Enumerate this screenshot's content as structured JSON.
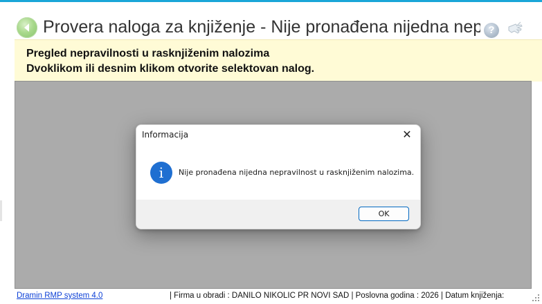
{
  "window": {
    "title": "Provera naloga za knjiženje - Nije pronađena nijedna nepravilnost",
    "back_icon": "back-arrow-icon",
    "help_icon": "help-icon",
    "help_glyph": "?",
    "pointer_icon": "hand-pointer-icon"
  },
  "info_bar": {
    "line1": "Pregled nepravilnosti u rasknjiženim nalozima",
    "line2": "Dvoklikom ili desnim klikom otvorite selektovan nalog."
  },
  "dialog": {
    "title": "Informacija",
    "close_glyph": "✕",
    "icon": "info-icon",
    "icon_glyph": "i",
    "message": "Nije pronađena nijedna nepravilnost u rasknjiženim nalozima.",
    "ok_label": "OK"
  },
  "statusbar": {
    "app_link": "Dramin RMP system 4.0",
    "info": "|  Firma u obradi : DANILO NIKOLIC PR NOVI SAD  |  Poslovna godina : 2026  |  Datum knjiženja:"
  },
  "colors": {
    "accent_line": "#1aa6d8",
    "info_bar_bg": "#fffbd6",
    "grid_bg": "#ababab",
    "info_icon": "#1f6fd1",
    "ok_border": "#0067c0",
    "link": "#0b3fd6"
  }
}
